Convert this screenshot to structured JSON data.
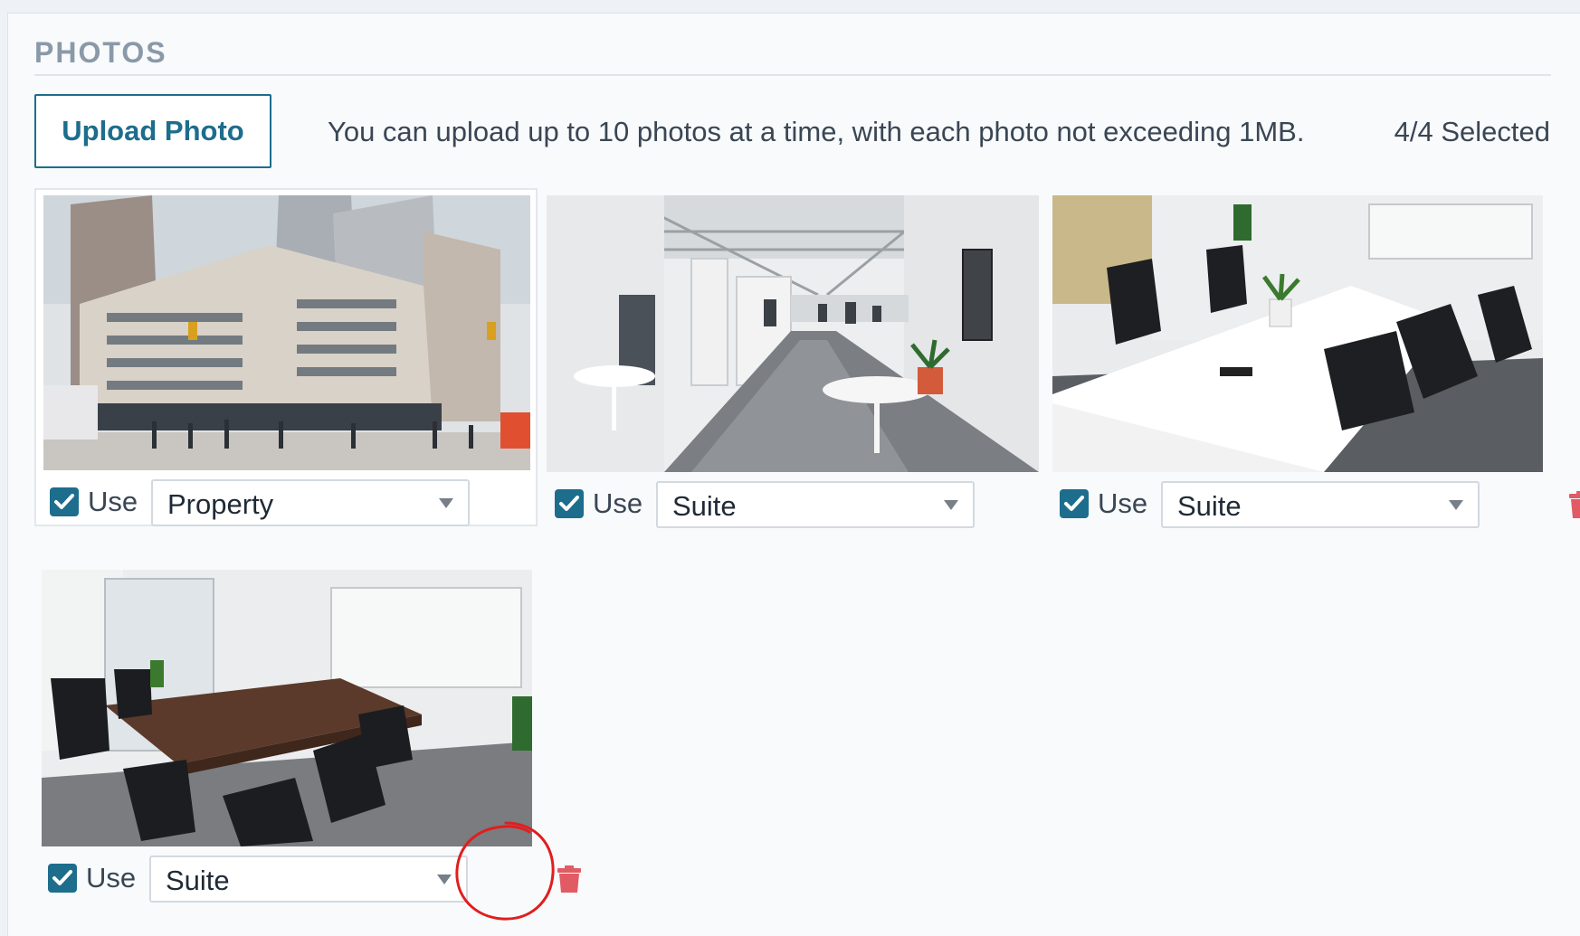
{
  "section": {
    "title": "PHOTOS"
  },
  "toolbar": {
    "upload_label": "Upload Photo",
    "help_text": "You can upload up to 10 photos at a time, with each photo not exceeding 1MB.",
    "selected_count": "4/4 Selected"
  },
  "photos": [
    {
      "use_label": "Use",
      "use_checked": true,
      "category": "Property",
      "scene": "street-view-office-building"
    },
    {
      "use_label": "Use",
      "use_checked": true,
      "category": "Suite",
      "scene": "open-office-floor"
    },
    {
      "use_label": "Use",
      "use_checked": true,
      "category": "Suite",
      "scene": "meeting-room-white-table"
    },
    {
      "use_label": "Use",
      "use_checked": true,
      "category": "Suite",
      "scene": "boardroom-wood-table"
    }
  ],
  "icons": {
    "checkbox": "checkmark-icon",
    "delete": "trash-icon",
    "dropdown": "caret-down-icon"
  },
  "colors": {
    "accent": "#1d6d8c",
    "delete": "#e15b64",
    "annotation": "#e01e1e",
    "heading": "#8a99a8"
  }
}
